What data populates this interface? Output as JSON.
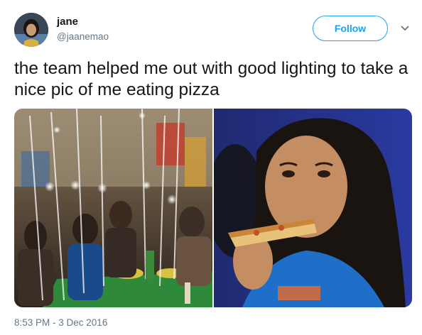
{
  "user": {
    "name": "jane",
    "handle": "@jaanemao"
  },
  "follow_button": {
    "label": "Follow"
  },
  "icons": {
    "menu": "chevron-down-icon"
  },
  "tweet": {
    "text": "the team helped me out with good lighting to take a nice pic of me eating pizza",
    "timestamp": "8:53 PM - 3 Dec 2016"
  },
  "colors": {
    "accent": "#1da1f2",
    "secondary_text": "#657786",
    "primary_text": "#14171a"
  }
}
